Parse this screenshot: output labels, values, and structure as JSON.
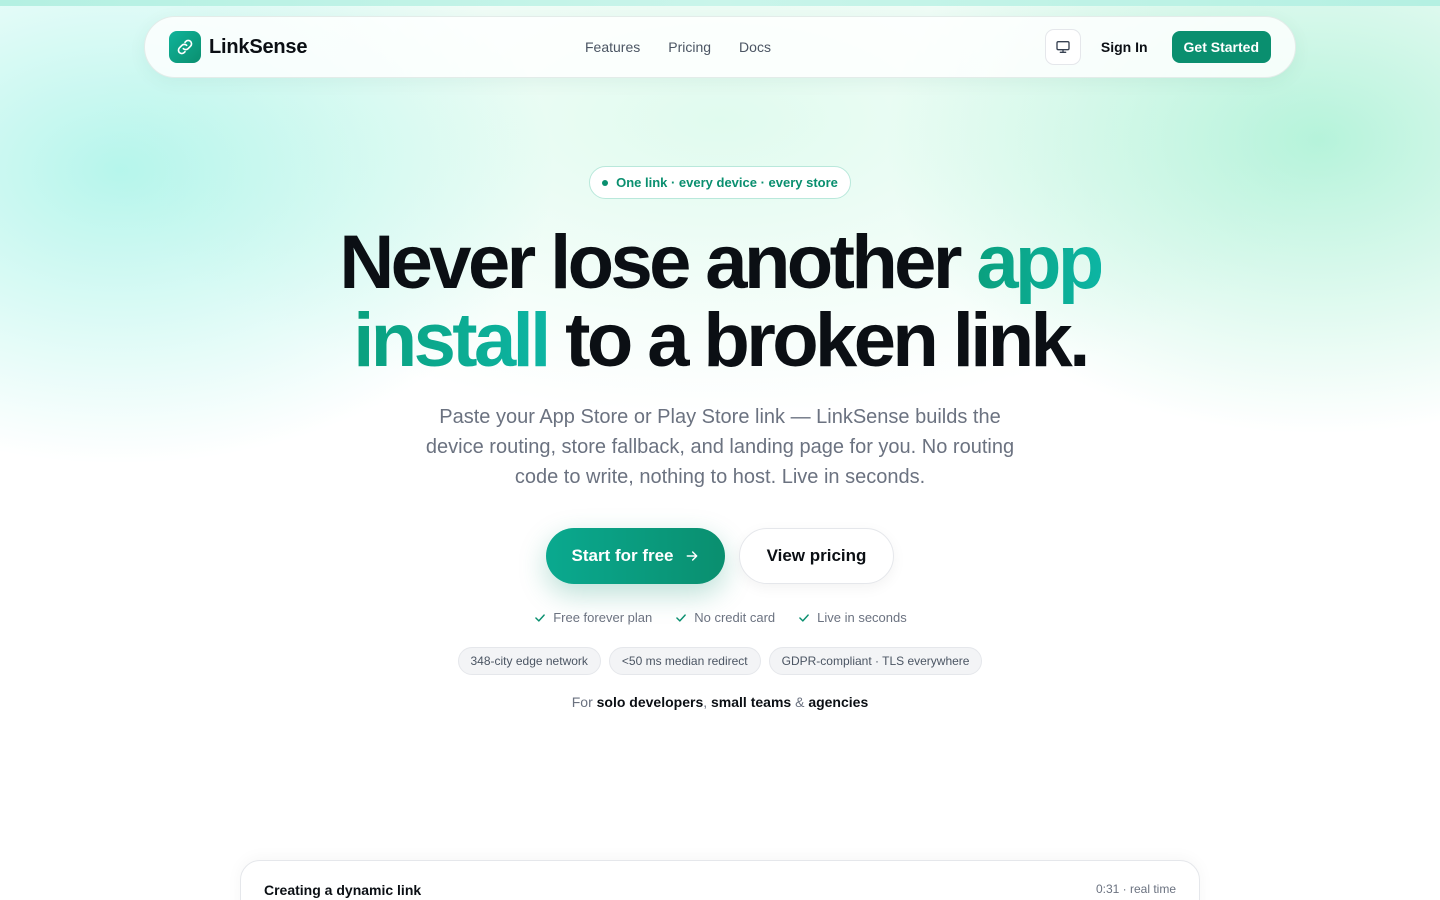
{
  "brand": {
    "name": "LinkSense",
    "accent": "#0a8f6f"
  },
  "nav": {
    "links": [
      "Features",
      "Pricing",
      "Docs"
    ],
    "theme_icon": "monitor-icon",
    "sign_in": "Sign In",
    "get_started": "Get Started"
  },
  "hero": {
    "badge": "One link · every device · every store",
    "headline_part1": "Never lose another ",
    "headline_accent1": "app",
    "headline_accent2": "install",
    "headline_part2": " to a broken link.",
    "subtitle": "Paste your App Store or Play Store link — LinkSense builds the device routing, store fallback, and landing page for you. No routing code to write, nothing to host. Live in seconds.",
    "primary_cta": "Start for free",
    "secondary_cta": "View pricing",
    "checks": [
      "Free forever plan",
      "No credit card",
      "Live in seconds"
    ],
    "pills": [
      "348-city edge network",
      "<50 ms median redirect",
      "GDPR-compliant · TLS everywhere"
    ],
    "audience": {
      "prefix": "For ",
      "a": "solo developers",
      "sep1": ", ",
      "b": "small teams",
      "sep2": " & ",
      "c": "agencies"
    }
  },
  "demo_card": {
    "title": "Creating a dynamic link",
    "meta": "0:31 · real time"
  }
}
